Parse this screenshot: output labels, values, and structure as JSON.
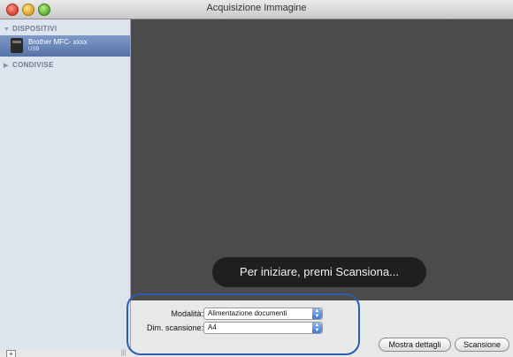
{
  "window": {
    "title": "Acquisizione Immagine"
  },
  "sidebar": {
    "section_devices": "DISPOSITIVI",
    "device": {
      "name": "Brother MFC- xxxx",
      "connection": "USB"
    },
    "section_shared": "CONDIVISE"
  },
  "preview": {
    "message": "Per iniziare, premi Scansiona..."
  },
  "settings": {
    "mode_label": "Modalità:",
    "mode_value": "Alimentazione documenti",
    "size_label": "Dim. scansione:",
    "size_value": "A4"
  },
  "buttons": {
    "details": "Mostra dettagli",
    "scan": "Scansione"
  },
  "icons": {
    "add": "plus-icon",
    "device": "printer-icon",
    "resize": "resize-grip-icon",
    "popup": "chevron-updown-icon"
  },
  "colors": {
    "selection": "#5673a8",
    "preview_bg": "#4b4b4b",
    "highlight_ring": "#2b5fae"
  }
}
